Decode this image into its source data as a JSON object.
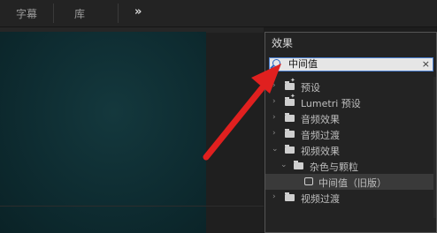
{
  "header": {
    "tabs": [
      {
        "label": "字幕"
      },
      {
        "label": "库"
      }
    ],
    "overflow_label": "»"
  },
  "effects_panel": {
    "title": "效果",
    "menu_label": "≡",
    "search": {
      "value": "中间值",
      "clear_label": "×"
    },
    "tree": [
      {
        "label": "预设"
      },
      {
        "label": "Lumetri 预设"
      },
      {
        "label": "音频效果"
      },
      {
        "label": "音频过渡"
      },
      {
        "label": "视频效果"
      },
      {
        "label": "杂色与颗粒"
      },
      {
        "label": "中间值（旧版）"
      },
      {
        "label": "视频过渡"
      }
    ]
  },
  "annotation": {
    "color": "#e0201f"
  }
}
